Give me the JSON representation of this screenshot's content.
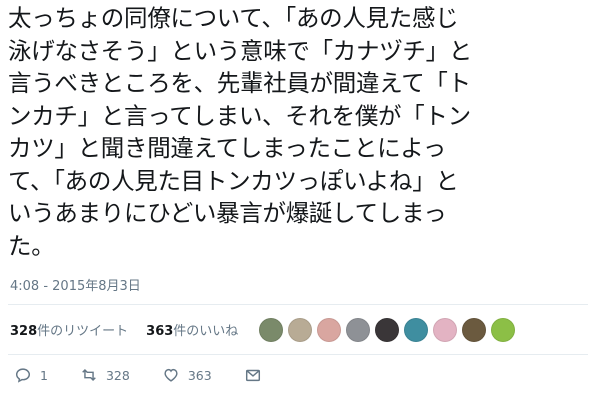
{
  "tweet": {
    "text": "太っちょの同僚について、「あの人見た感じ\n泳げなさそう」という意味で「カナヅチ」と\n言うべきところを、先輩社員が間違えて「ト\nンカチ」と言ってしまい、それを僕が「トン\nカツ」と聞き間違えてしまったことによっ\nて、「あの人見た目トンカツっぽいよね」と\nいうあまりにひどい暴言が爆誕してしまっ\nた。",
    "timestamp": "4:08 - 2015年8月3日"
  },
  "stats": {
    "retweet_count": "328",
    "retweet_label": "件のリツイート",
    "like_count": "363",
    "like_label": "件のいいね"
  },
  "avatars": [
    {
      "color": "#7a8a6a"
    },
    {
      "color": "#b8ab95"
    },
    {
      "color": "#d9a6a0"
    },
    {
      "color": "#8e9196"
    },
    {
      "color": "#3a3638"
    },
    {
      "color": "#3f8ea0"
    },
    {
      "color": "#e3b3c3"
    },
    {
      "color": "#6b5a3f"
    },
    {
      "color": "#8cbf46"
    }
  ],
  "actions": {
    "reply_count": "1",
    "retweet_count": "328",
    "like_count": "363",
    "icons": [
      "reply-icon",
      "retweet-icon",
      "heart-icon",
      "message-icon"
    ]
  }
}
